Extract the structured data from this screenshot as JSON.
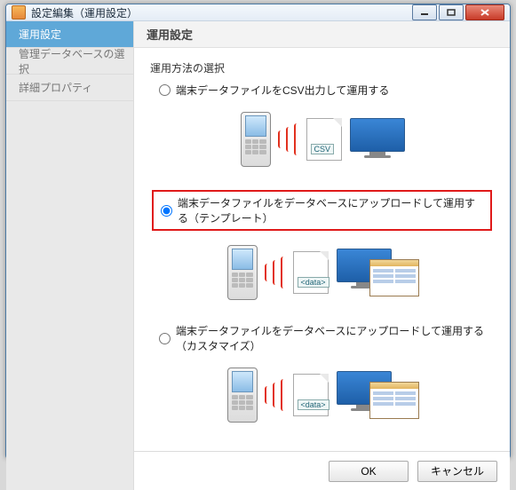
{
  "window": {
    "title": "設定編集（運用設定）"
  },
  "sidebar": {
    "items": [
      {
        "label": "運用設定"
      },
      {
        "label": "管理データベースの選択"
      },
      {
        "label": "詳細プロパティ"
      }
    ],
    "selected_index": 0
  },
  "main": {
    "header": "運用設定",
    "group_label": "運用方法の選択",
    "options": [
      {
        "label": "端末データファイルをCSV出力して運用する",
        "doc_tag": "CSV",
        "show_appwin": false
      },
      {
        "label": "端末データファイルをデータベースにアップロードして運用する（テンプレート）",
        "doc_tag": "<data>",
        "show_appwin": true
      },
      {
        "label": "端末データファイルをデータベースにアップロードして運用する（カスタマイズ）",
        "doc_tag": "<data>",
        "show_appwin": true
      }
    ],
    "selected_option": 1,
    "highlight_option": 1
  },
  "footer": {
    "ok": "OK",
    "cancel": "キャンセル"
  }
}
